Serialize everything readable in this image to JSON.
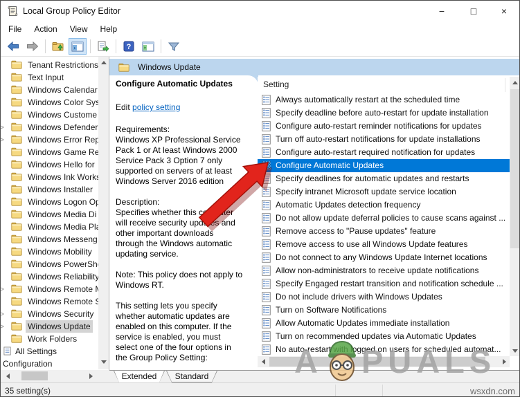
{
  "window": {
    "title": "Local Group Policy Editor",
    "controls": {
      "minimize": "−",
      "maximize": "□",
      "close": "×"
    }
  },
  "menubar": {
    "items": [
      "File",
      "Action",
      "View",
      "Help"
    ]
  },
  "toolbar": {
    "icons": [
      "back-icon",
      "forward-icon",
      "up-one-level-icon",
      "console-tree-icon",
      "export-list-icon",
      "help-icon",
      "action-pane-icon",
      "filter-icon"
    ]
  },
  "icons": {
    "tree_chevron": ">"
  },
  "tree": {
    "items": [
      {
        "label": "Tenant Restrictions",
        "icon": "folder",
        "expandable": false,
        "selected": false
      },
      {
        "label": "Text Input",
        "icon": "folder",
        "expandable": false,
        "selected": false
      },
      {
        "label": "Windows Calendar",
        "icon": "folder",
        "expandable": false,
        "selected": false
      },
      {
        "label": "Windows Color Sys",
        "icon": "folder",
        "expandable": false,
        "selected": false
      },
      {
        "label": "Windows Custome",
        "icon": "folder",
        "expandable": false,
        "selected": false
      },
      {
        "label": "Windows Defender",
        "icon": "folder",
        "expandable": true,
        "selected": false
      },
      {
        "label": "Windows Error Rep",
        "icon": "folder",
        "expandable": true,
        "selected": false
      },
      {
        "label": "Windows Game Re",
        "icon": "folder",
        "expandable": false,
        "selected": false
      },
      {
        "label": "Windows Hello for",
        "icon": "folder",
        "expandable": false,
        "selected": false
      },
      {
        "label": "Windows Ink Works",
        "icon": "folder",
        "expandable": false,
        "selected": false
      },
      {
        "label": "Windows Installer",
        "icon": "folder",
        "expandable": false,
        "selected": false
      },
      {
        "label": "Windows Logon Op",
        "icon": "folder",
        "expandable": false,
        "selected": false
      },
      {
        "label": "Windows Media Di",
        "icon": "folder",
        "expandable": false,
        "selected": false
      },
      {
        "label": "Windows Media Pla",
        "icon": "folder",
        "expandable": false,
        "selected": false
      },
      {
        "label": "Windows Messeng",
        "icon": "folder",
        "expandable": false,
        "selected": false
      },
      {
        "label": "Windows Mobility",
        "icon": "folder",
        "expandable": false,
        "selected": false
      },
      {
        "label": "Windows PowerShe",
        "icon": "folder",
        "expandable": false,
        "selected": false
      },
      {
        "label": "Windows Reliability",
        "icon": "folder",
        "expandable": false,
        "selected": false
      },
      {
        "label": "Windows Remote M",
        "icon": "folder",
        "expandable": true,
        "selected": false
      },
      {
        "label": "Windows Remote S",
        "icon": "folder",
        "expandable": false,
        "selected": false
      },
      {
        "label": "Windows Security",
        "icon": "folder",
        "expandable": true,
        "selected": false
      },
      {
        "label": "Windows Update",
        "icon": "folder",
        "expandable": true,
        "selected": true
      },
      {
        "label": "Work Folders",
        "icon": "folder",
        "expandable": false,
        "selected": false
      },
      {
        "label": "All Settings",
        "icon": "settings",
        "expandable": false,
        "selected": false
      },
      {
        "label": "Configuration",
        "icon": "none",
        "expandable": false,
        "selected": false
      }
    ]
  },
  "content": {
    "header_title": "Windows Update",
    "details": {
      "title": "Configure Automatic Updates",
      "edit_prefix": "Edit ",
      "edit_link": "policy setting",
      "requirements": "Requirements:\nWindows XP Professional Service Pack 1 or At least Windows 2000 Service Pack 3 Option 7 only supported on servers of at least Windows Server 2016 edition",
      "description": "Description:\nSpecifies whether this computer will receive security updates and other important downloads through the Windows automatic updating service.",
      "note": "Note: This policy does not apply to Windows RT.",
      "extra": "This setting lets you specify whether automatic updates are enabled on this computer. If the service is enabled, you must select one of the four options in the Group Policy Setting:"
    },
    "list": {
      "column_header": "Setting",
      "selected_index": 5,
      "items": [
        "Always automatically restart at the scheduled time",
        "Specify deadline before auto-restart for update installation",
        "Configure auto-restart reminder notifications for updates",
        "Turn off auto-restart notifications for update installations",
        "Configure auto-restart required notification for updates",
        "Configure Automatic Updates",
        "Specify deadlines for automatic updates and restarts",
        "Specify intranet Microsoft update service location",
        "Automatic Updates detection frequency",
        "Do not allow update deferral policies to cause scans against ...",
        "Remove access to \"Pause updates\" feature",
        "Remove access to use all Windows Update features",
        "Do not connect to any Windows Update Internet locations",
        "Allow non-administrators to receive update notifications",
        "Specify Engaged restart transition and notification schedule ...",
        "Do not include drivers with Windows Updates",
        "Turn on Software Notifications",
        "Allow Automatic Updates immediate installation",
        "Turn on recommended updates via Automatic Updates",
        "No auto-restart with logged on users for scheduled automat..."
      ]
    }
  },
  "tabs": {
    "items": [
      {
        "label": "Extended",
        "active": true
      },
      {
        "label": "Standard",
        "active": false
      }
    ]
  },
  "statusbar": {
    "left": "35 setting(s)",
    "right": "wsxdn.com"
  },
  "watermark": {
    "part1": "A",
    "part2": "PUALS",
    "mascot": "appuals-mascot-icon"
  },
  "colors": {
    "accent": "#0078d7",
    "header_blue": "#bcd6ee",
    "tree_selection": "#d4d4d4",
    "arrow_red": "#e2241c"
  }
}
